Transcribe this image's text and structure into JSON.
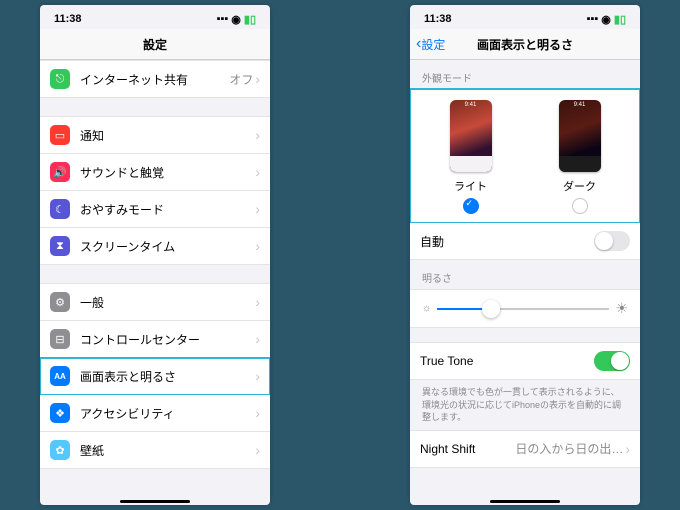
{
  "status": {
    "time": "11:38"
  },
  "left": {
    "title": "設定",
    "items": {
      "hotspot": {
        "label": "インターネット共有",
        "value": "オフ"
      },
      "notif": {
        "label": "通知"
      },
      "sound": {
        "label": "サウンドと触覚"
      },
      "dnd": {
        "label": "おやすみモード"
      },
      "screentime": {
        "label": "スクリーンタイム"
      },
      "general": {
        "label": "一般"
      },
      "control": {
        "label": "コントロールセンター"
      },
      "display": {
        "label": "画面表示と明るさ"
      },
      "access": {
        "label": "アクセシビリティ"
      },
      "wallpaper": {
        "label": "壁紙"
      }
    }
  },
  "right": {
    "back": "設定",
    "title": "画面表示と明るさ",
    "appearance": {
      "header": "外観モード",
      "light": "ライト",
      "dark": "ダーク",
      "preview_time": "9:41",
      "selected": "light"
    },
    "auto": {
      "label": "自動",
      "on": false
    },
    "brightness": {
      "header": "明るさ",
      "value": 0.28
    },
    "truetone": {
      "label": "True Tone",
      "on": true,
      "desc": "異なる環境でも色が一貫して表示されるように、環境光の状況に応じてiPhoneの表示を自動的に調整します。"
    },
    "nightshift": {
      "label": "Night Shift",
      "value": "日の入から日の出…"
    }
  },
  "icons": {
    "hotspot": {
      "bg": "#34c759",
      "glyph": "⎋"
    },
    "notif": {
      "bg": "#ff3b30",
      "glyph": "▭"
    },
    "sound": {
      "bg": "#ff2d55",
      "glyph": "🔊"
    },
    "dnd": {
      "bg": "#5856d6",
      "glyph": "☾"
    },
    "screentime": {
      "bg": "#5856d6",
      "glyph": "⧗"
    },
    "general": {
      "bg": "#8e8e93",
      "glyph": "⚙"
    },
    "control": {
      "bg": "#8e8e93",
      "glyph": "⊟"
    },
    "display": {
      "bg": "#007aff",
      "glyph": "AA"
    },
    "access": {
      "bg": "#007aff",
      "glyph": "❖"
    },
    "wallpaper": {
      "bg": "#54c7fc",
      "glyph": "✿"
    }
  }
}
